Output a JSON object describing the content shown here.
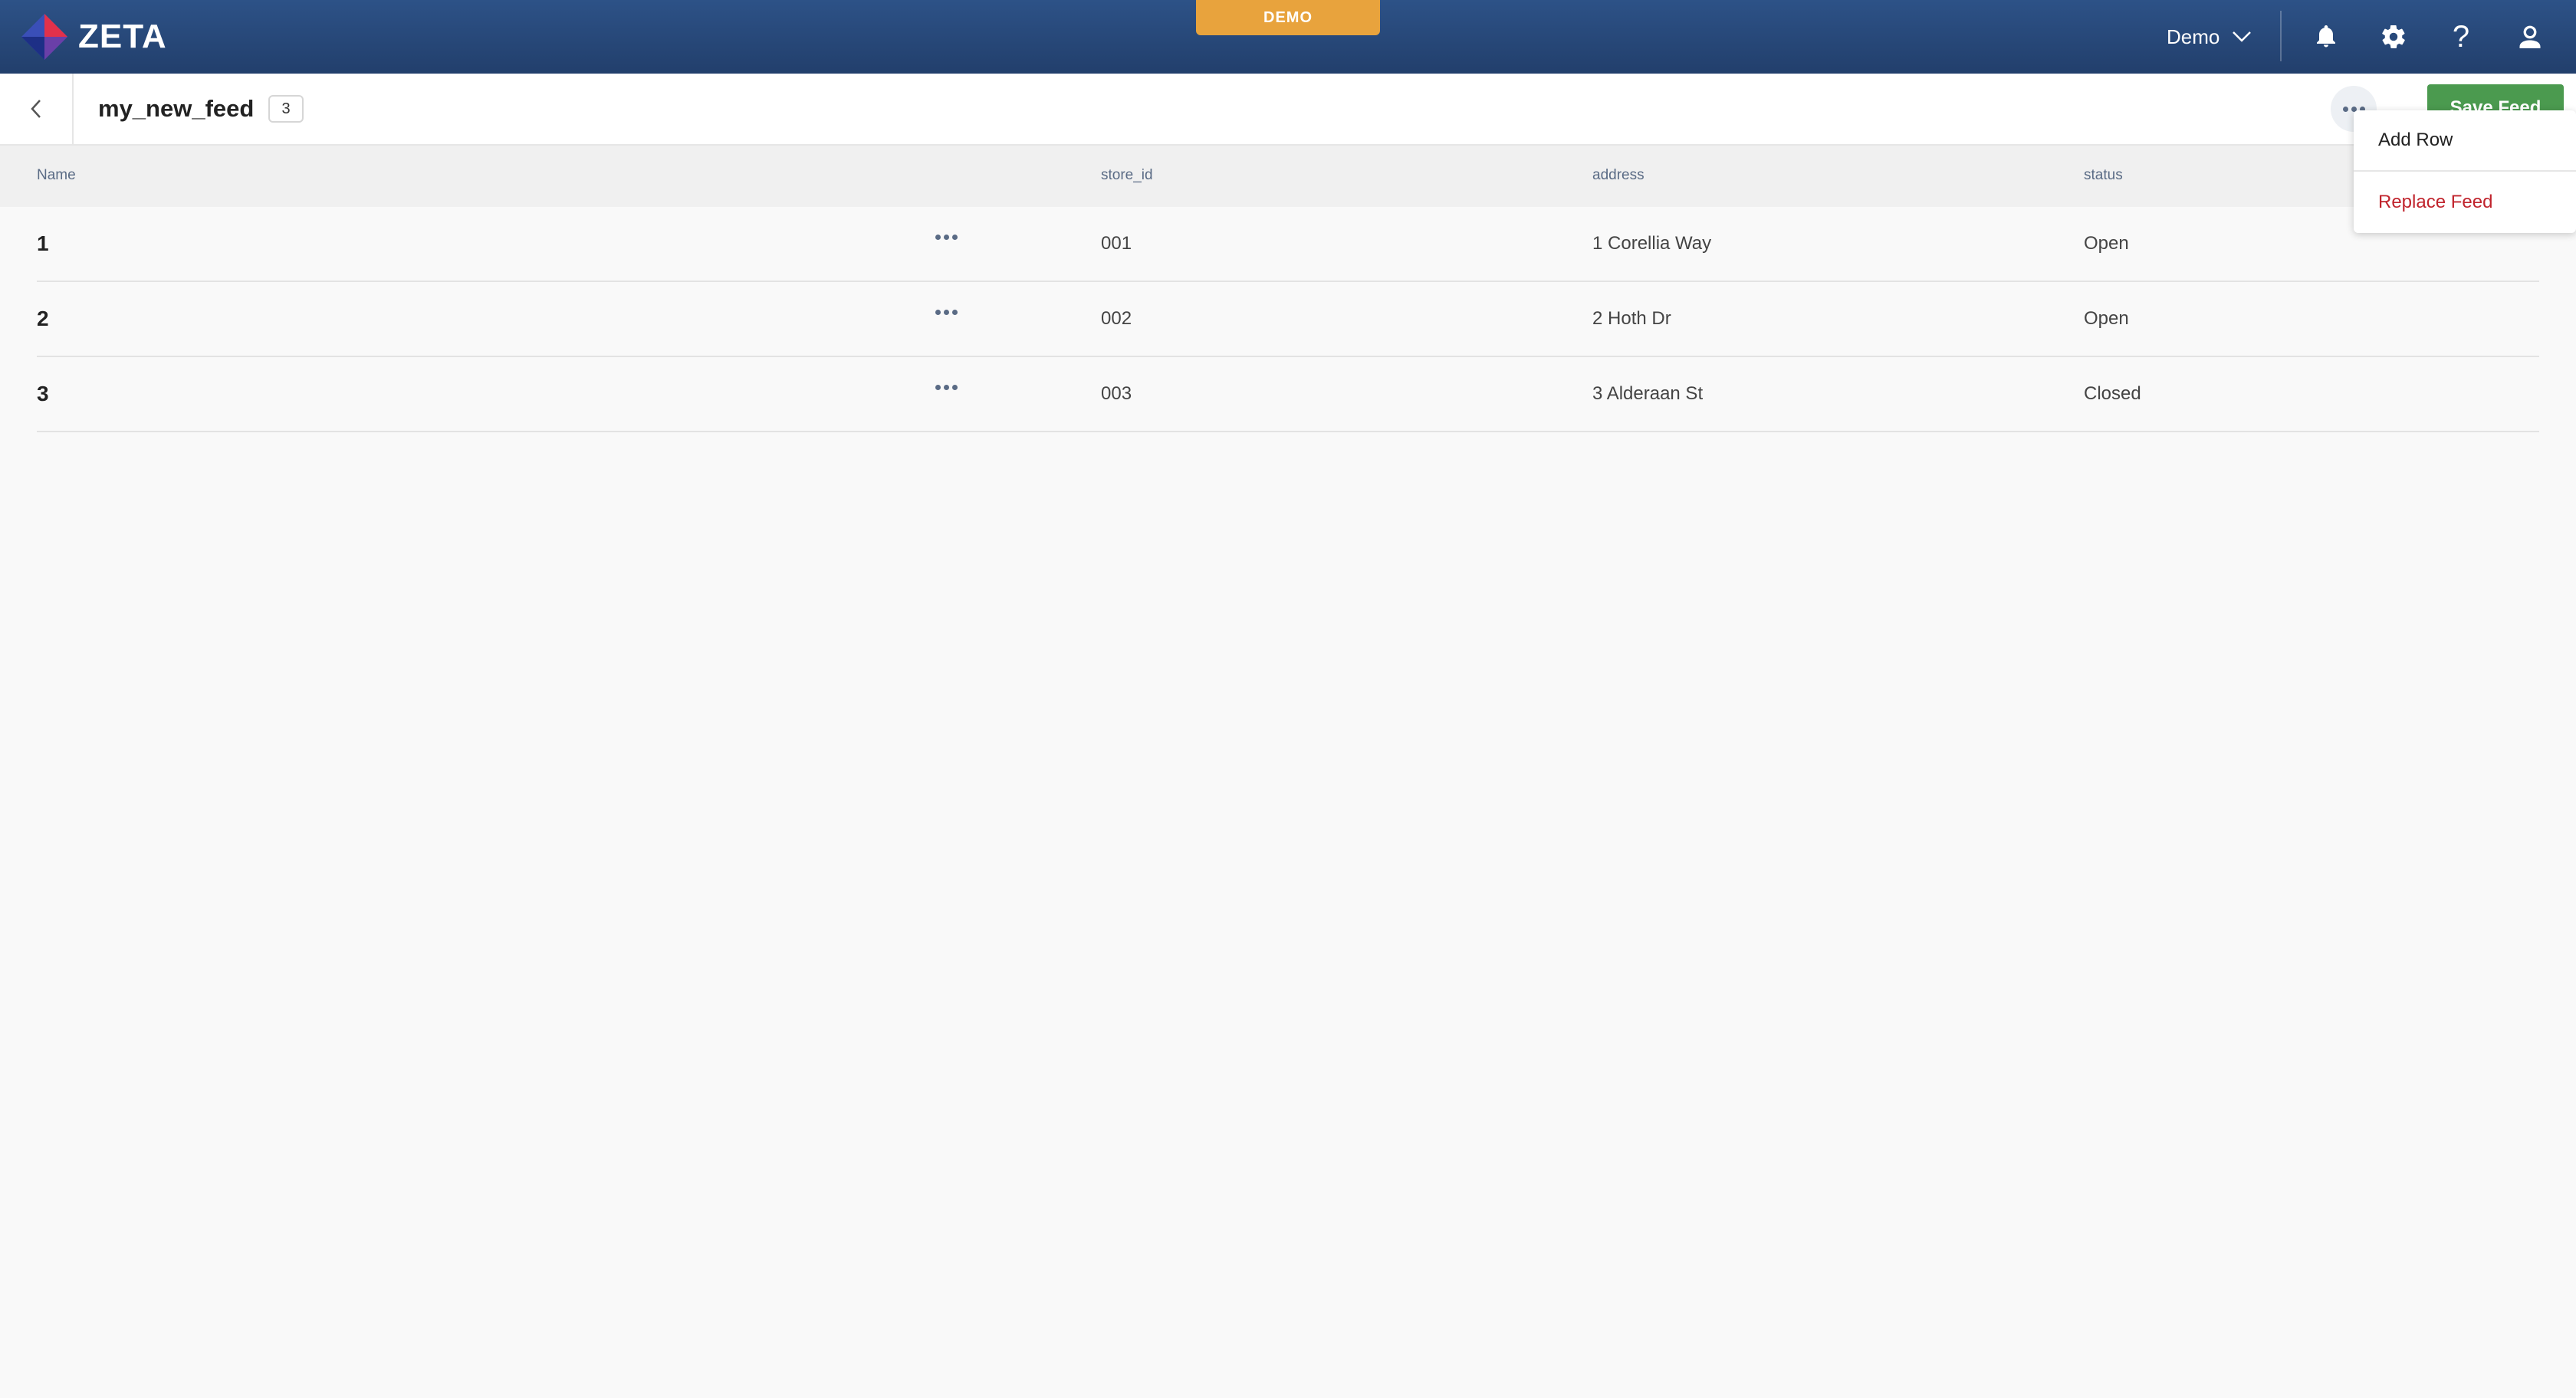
{
  "app": {
    "logo_text": "ZETA",
    "banner": "DEMO",
    "account_label": "Demo",
    "help_glyph": "?"
  },
  "icons": {
    "bell": "bell-icon",
    "settings": "gear-icon",
    "help": "question-icon",
    "user": "user-icon",
    "back": "chevron-left-icon",
    "more": "ellipsis-icon"
  },
  "colors": {
    "nav_bg": "#2a4c80",
    "banner": "#e8a33d",
    "save_button": "#4b9a4f",
    "danger": "#c0232c"
  },
  "feed": {
    "title": "my_new_feed",
    "count": "3",
    "save_label": "Save Feed"
  },
  "menu": {
    "items": [
      {
        "label": "Add Row"
      },
      {
        "label": "Replace Feed"
      }
    ]
  },
  "table": {
    "columns": [
      "Name",
      "store_id",
      "address",
      "status"
    ],
    "rows": [
      {
        "name": "1",
        "store_id": "001",
        "address": "1 Corellia Way",
        "status": "Open"
      },
      {
        "name": "2",
        "store_id": "002",
        "address": "2 Hoth Dr",
        "status": "Open"
      },
      {
        "name": "3",
        "store_id": "003",
        "address": "3 Alderaan St",
        "status": "Closed"
      }
    ]
  }
}
